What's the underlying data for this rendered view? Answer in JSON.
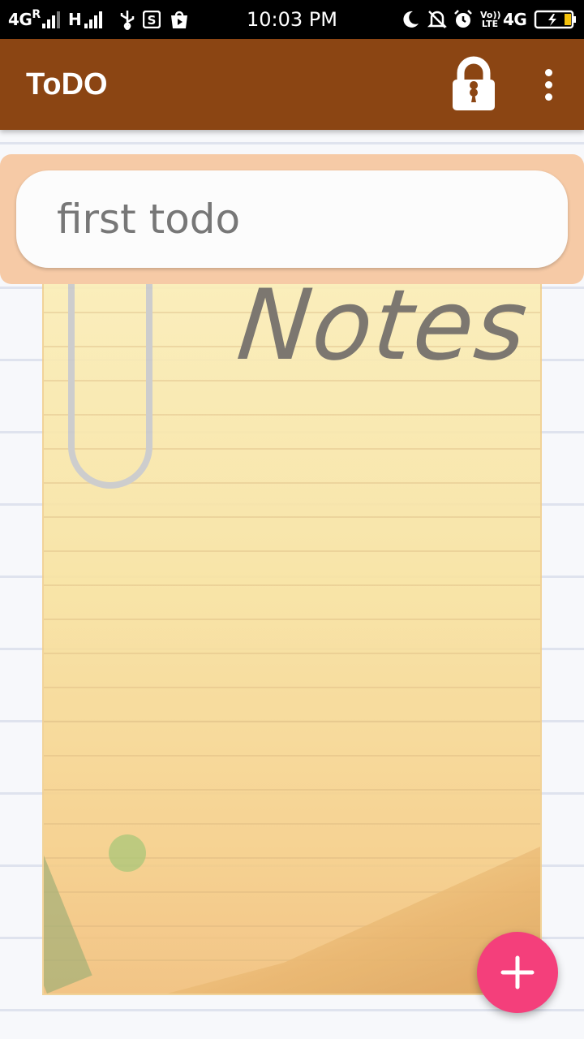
{
  "status_bar": {
    "network_left": "4G",
    "roaming": "R",
    "network_h": "H",
    "time": "10:03 PM",
    "volte": "Vo)) LTE",
    "network_right": "4G",
    "icons": [
      "usb-icon",
      "s-app-icon",
      "play-store-icon",
      "moon-icon",
      "bell-off-icon",
      "alarm-icon",
      "battery-charging-icon"
    ]
  },
  "app_bar": {
    "title": "ToDO",
    "lock_icon": "lock-icon",
    "menu_icon": "overflow-menu-icon"
  },
  "background": {
    "notepad_title": "Notes"
  },
  "todos": [
    {
      "text": "first todo"
    }
  ],
  "fab": {
    "icon": "plus-icon",
    "color": "#f43f7b"
  },
  "colors": {
    "app_bar": "#8b4513",
    "todo_card": "#f6caa6",
    "fab": "#f43f7b"
  }
}
